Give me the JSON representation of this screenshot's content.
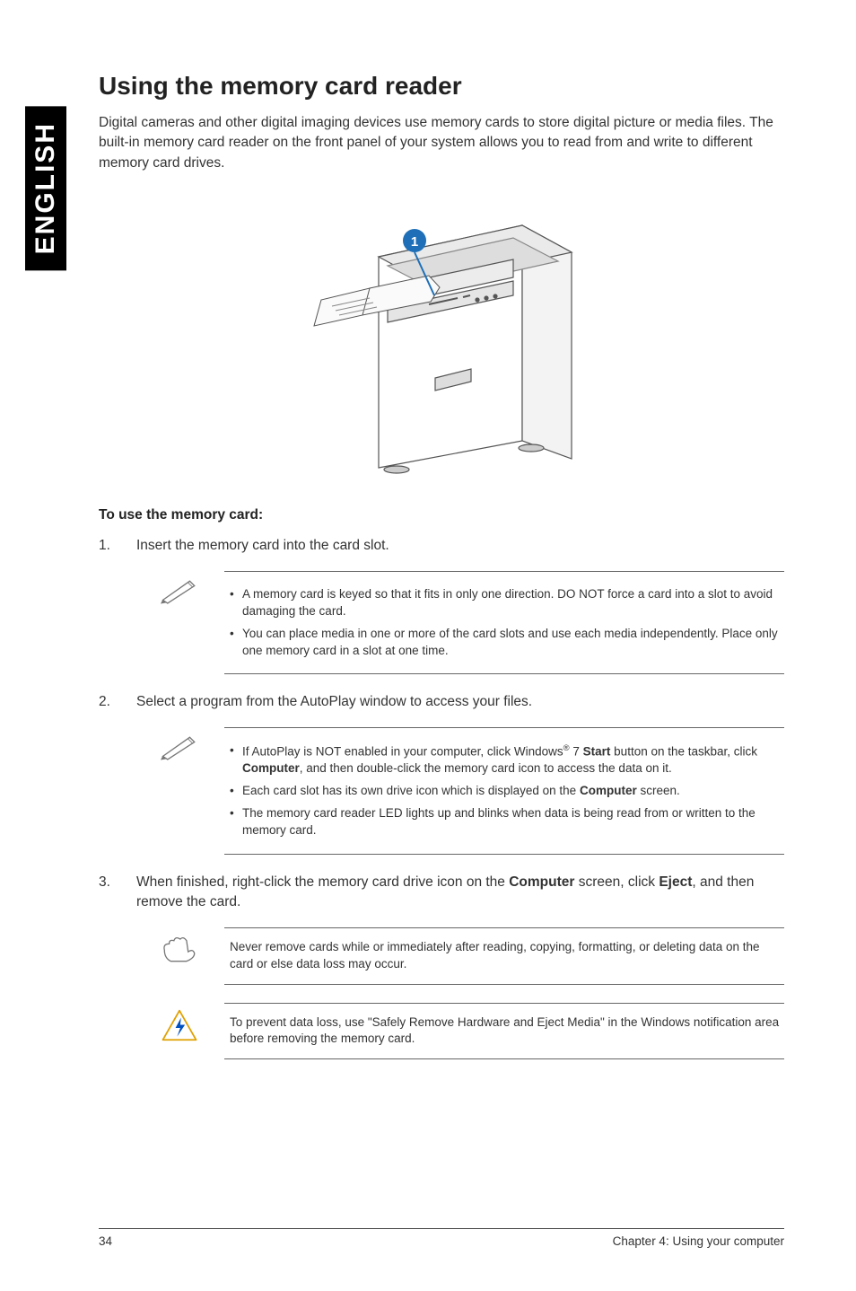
{
  "side_tab": "ENGLISH",
  "title": "Using the memory card reader",
  "intro": "Digital cameras and other digital imaging devices use memory cards to store digital picture or media files. The built-in memory card reader on the front panel of your system allows you to read from and write to different memory card drives.",
  "callout_number": "1",
  "subhead": "To use the memory card:",
  "steps": {
    "s1": "Insert the memory card into the card slot.",
    "s2": "Select a program from the AutoPlay window to access your files.",
    "s3_pre": "When finished, right-click the memory card drive icon on the ",
    "s3_bold1": "Computer",
    "s3_mid": " screen, click ",
    "s3_bold2": "Eject",
    "s3_post": ", and then remove the card."
  },
  "note1": {
    "li1": "A memory card is keyed so that it fits in only one direction. DO NOT force a card into a slot to avoid damaging the card.",
    "li2": "You can place media in one or more of the card slots and use each media independently. Place only one memory card in a slot at one time."
  },
  "note2": {
    "li1_pre": "If AutoPlay is NOT enabled in your computer, click Windows",
    "li1_sup": "®",
    "li1_mid1": " 7 ",
    "li1_b1": "Start",
    "li1_mid2": " button on the taskbar, click ",
    "li1_b2": "Computer",
    "li1_post": ", and then double-click the memory card icon to access the data on it.",
    "li2_pre": "Each card slot has its own drive icon which is displayed on the ",
    "li2_b": "Computer",
    "li2_post": " screen.",
    "li3": "The memory card reader LED lights up and blinks when data is being read from or written to the memory card."
  },
  "note3": "Never remove cards while or immediately after reading, copying, formatting, or deleting data on the card or else data loss may occur.",
  "note4": "To prevent data loss, use \"Safely Remove Hardware and Eject Media\" in the Windows notification area before removing the memory card.",
  "footer": {
    "page": "34",
    "chapter": "Chapter 4: Using your computer"
  }
}
